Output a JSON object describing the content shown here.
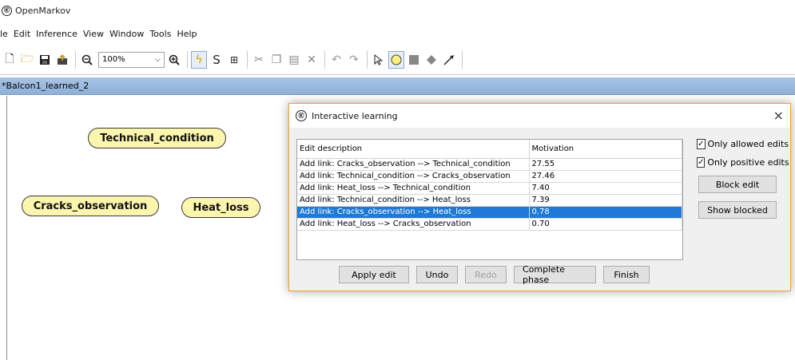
{
  "app": {
    "title": "OpenMarkov",
    "logo": "Ⓚ"
  },
  "menu": [
    "le",
    "Edit",
    "Inference",
    "View",
    "Window",
    "Tools",
    "Help"
  ],
  "toolbar": {
    "zoom_value": "100%",
    "icons": [
      "new-file-icon",
      "open-folder-icon",
      "save-icon",
      "upload-icon",
      "zoom-out-icon",
      "zoom-in-icon",
      "flash-icon",
      "s-icon",
      "network-icon",
      "cut-icon",
      "copy-icon",
      "paste-icon",
      "delete-icon",
      "undo-icon",
      "redo-icon",
      "pointer-icon",
      "circle-node-icon",
      "square-node-icon",
      "diamond-node-icon",
      "link-arrow-icon"
    ]
  },
  "document_tab": {
    "label": "*Balcon1_learned_2"
  },
  "nodes": [
    {
      "label": "Technical_condition"
    },
    {
      "label": "Cracks_observation"
    },
    {
      "label": "Heat_loss"
    }
  ],
  "dialog": {
    "title": "Interactive learning",
    "close_label": "×",
    "table": {
      "headers": [
        "Edit description",
        "Motivation"
      ],
      "rows": [
        [
          "Add link: Cracks_observation --> Technical_condition",
          "27.55"
        ],
        [
          "Add link: Technical_condition --> Cracks_observation",
          "27.46"
        ],
        [
          "Add link: Heat_loss --> Technical_condition",
          "7.40"
        ],
        [
          "Add link: Technical_condition --> Heat_loss",
          "7.39"
        ],
        [
          "Add link: Cracks_observation --> Heat_loss",
          "0.78"
        ],
        [
          "Add link: Heat_loss --> Cracks_observation",
          "0.70"
        ]
      ],
      "selected_row": 4
    },
    "checks": [
      {
        "label": "Only allowed edits",
        "checked": true
      },
      {
        "label": "Only positive edits",
        "checked": true
      }
    ],
    "side_buttons": [
      "Block edit",
      "Show blocked"
    ],
    "buttons": [
      "Apply edit",
      "Undo",
      "Redo",
      "Complete phase",
      "Finish"
    ]
  },
  "colors": {
    "selection": "#1e7ad6",
    "node_fill": "#fbf5ad",
    "tab_bar": "#a9c3e3",
    "dialog_border": "#f0a030"
  }
}
